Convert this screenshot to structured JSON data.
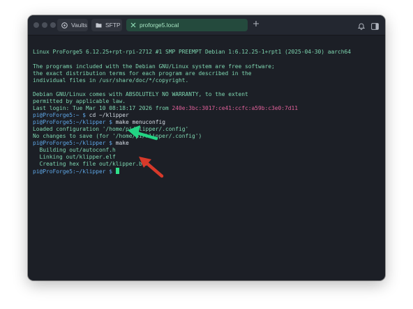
{
  "tabs": [
    {
      "label": "Vaults",
      "icon": "vault-icon"
    },
    {
      "label": "SFTP",
      "icon": "folder-icon"
    },
    {
      "label": "proforge5.local",
      "icon": "close-icon",
      "active": true
    }
  ],
  "colors": {
    "terminal_bg": "#1c1f26",
    "output_green": "#7ed6b0",
    "prompt_blue": "#5fa8e8",
    "ip_pink": "#e0609a",
    "cursor": "#2fe08a",
    "arrow_green": "#22d483",
    "arrow_red": "#d7392a"
  },
  "terminal": {
    "banner": "Linux ProForge5 6.12.25+rpt-rpi-2712 #1 SMP PREEMPT Debian 1:6.12.25-1+rpt1 (2025-04-30) aarch64",
    "programs_1": "The programs included with the Debian GNU/Linux system are free software;",
    "programs_2": "the exact distribution terms for each program are described in the",
    "programs_3": "individual files in /usr/share/doc/*/copyright.",
    "warranty_1": "Debian GNU/Linux comes with ABSOLUTELY NO WARRANTY, to the extent",
    "warranty_2": "permitted by applicable law.",
    "last_login_prefix": "Last login: Tue Mar 10 08:18:17 2026 from ",
    "last_login_ip": "240e:3bc:3017:ce41:ccfc:a59b:c3e0:7d11",
    "prompt_home": "pi@ProForge5:~ $",
    "cmd_cd": " cd ~/klipper",
    "prompt_klipper": "pi@ProForge5:~/klipper $",
    "cmd_menuconfig": " make menuconfig",
    "loaded_config": "Loaded configuration '/home/pi/klipper/.config'",
    "no_changes": "No changes to save (for '/home/pi/klipper/.config')",
    "cmd_make": " make",
    "building": "  Building out/autoconf.h",
    "linking": "  Linking out/klipper.elf",
    "creating": "  Creating hex file out/klipper.bin"
  }
}
